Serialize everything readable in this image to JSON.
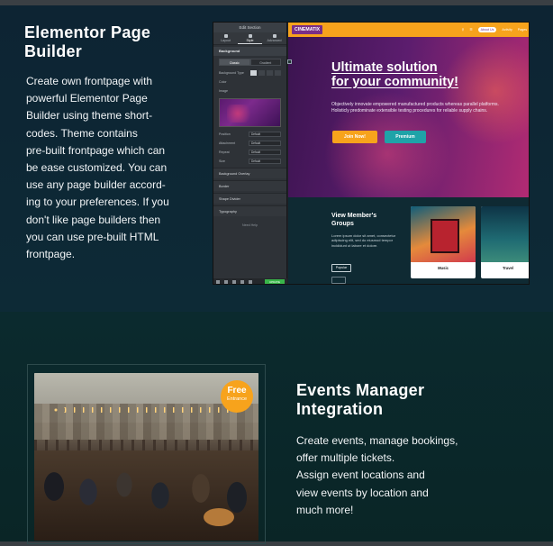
{
  "feature1": {
    "title_line1": "Elementor Page",
    "title_line2": "Builder",
    "desc_lines": [
      "Create own frontpage with",
      "powerful Elementor  Page",
      "Builder using theme short-",
      "codes.  Theme contains",
      "pre-built frontpage which can",
      "be ease customized. You can",
      "use any page builder accord-",
      "ing to your preferences. If you",
      "don't like page builders then",
      "you can use pre-built HTML",
      "frontpage."
    ]
  },
  "editor": {
    "header": "Edit Section",
    "tabs": [
      "Layout",
      "Style",
      "Advanced"
    ],
    "group_background": "Background",
    "toggle": [
      "Classic",
      "Gradient"
    ],
    "rows": {
      "bg_type": "Background Type",
      "color": "Color",
      "image": "Image",
      "position": "Position",
      "attachment": "Attachment",
      "repeat": "Repeat",
      "size": "Size"
    },
    "select_default": "Default",
    "folds": [
      "Background Overlay",
      "Border",
      "Shape Divider",
      "Typography"
    ],
    "help": "Need Help",
    "update": "UPDATE"
  },
  "site": {
    "logo": "CINEMATIX",
    "nav": [
      "About Us",
      "Activity",
      "Pages"
    ],
    "hero_line1": "Ultimate solution",
    "hero_line2": "for your community!",
    "hero_text": "Objectively innovate empowered manufactured products whereas parallel platforms. Holisticly predominate extensible testing procedures for reliable supply chains.",
    "btn_join": "Join Now!",
    "btn_premium": "Premium",
    "groups_line1": "View Member's",
    "groups_line2": "Groups",
    "groups_text": "Lorem ipsum dolor sit amet, consectetur adipiscing elit, sed do eiusmod tempor incididunt ut labore et dolore.",
    "btn_popular": "Popular",
    "card1": "Music",
    "card2": "Travel"
  },
  "feature2": {
    "title_line1": "Events Manager",
    "title_line2": "Integration",
    "desc_lines": [
      "Create events, manage bookings,",
      "offer multiple tickets.",
      "Assign event locations and",
      "view events by location and",
      "much more!"
    ],
    "badge_line1": "Free",
    "badge_line2": "Entrance"
  },
  "colors": {
    "background": "#0b2330",
    "accent_orange": "#f7a31c",
    "accent_teal": "#1fa3a8",
    "brand_purple": "#7a2f86"
  }
}
